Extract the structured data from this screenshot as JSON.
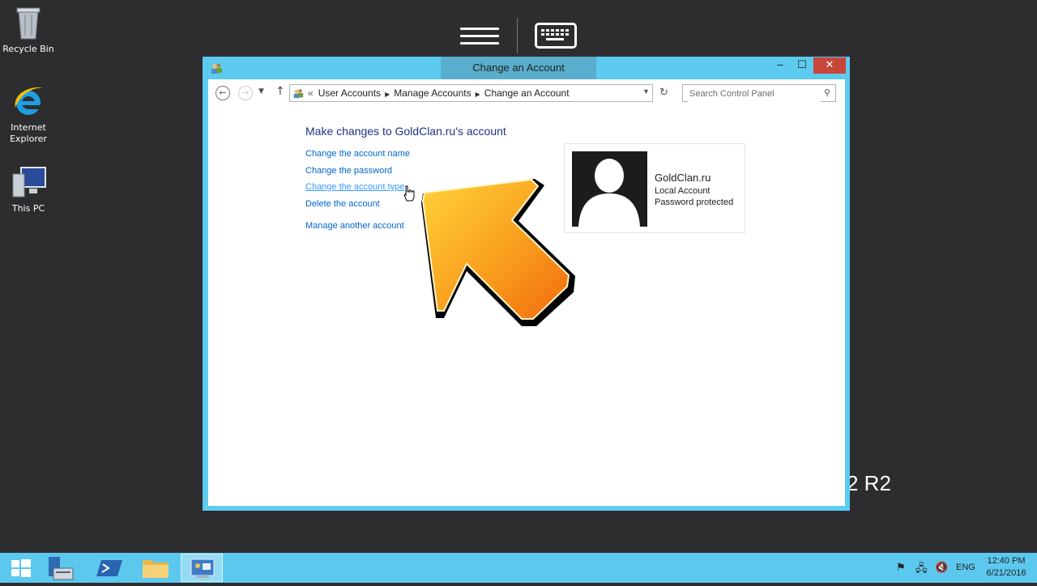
{
  "desktop": {
    "icons": [
      {
        "label": "Recycle Bin"
      },
      {
        "label": "Internet Explorer"
      },
      {
        "label": "This PC"
      }
    ],
    "background_text": "2 R2"
  },
  "window": {
    "title": "Change an Account",
    "buttons": {
      "minimize": "‒",
      "maximize": "☐",
      "close": "✕"
    },
    "breadcrumb": [
      "User Accounts",
      "Manage Accounts",
      "Change an Account"
    ],
    "breadcrumb_prefix": "«",
    "search": {
      "placeholder": "Search Control Panel"
    },
    "heading": "Make changes to GoldClan.ru's account",
    "tasks": [
      {
        "label": "Change the account name"
      },
      {
        "label": "Change the password"
      },
      {
        "label": "Change the account type"
      },
      {
        "label": "Delete the account"
      },
      {
        "label": "Manage another account"
      }
    ],
    "account": {
      "name": "GoldClan.ru",
      "type": "Local Account",
      "status": "Password protected"
    }
  },
  "taskbar": {
    "items": [
      "start-button",
      "server-manager",
      "powershell",
      "file-explorer",
      "control-panel"
    ],
    "tray": {
      "language": "ENG"
    },
    "clock": {
      "time": "12:40 PM",
      "date": "6/21/2016"
    }
  },
  "colors": {
    "accent": "#5cc8ee",
    "link": "#0066cc",
    "heading": "#1e3287",
    "close": "#c7463a",
    "desktop": "#2d2d30"
  }
}
